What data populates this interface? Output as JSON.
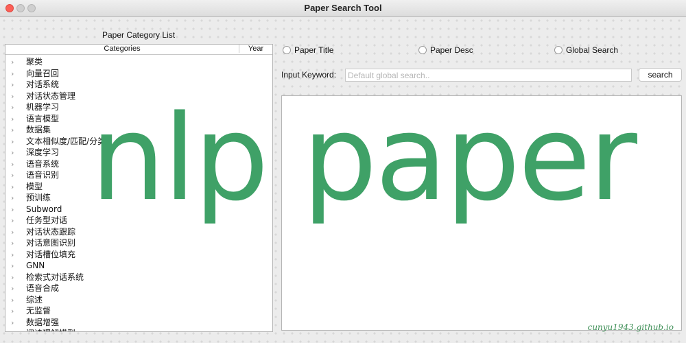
{
  "window": {
    "title": "Paper Search Tool"
  },
  "category_panel": {
    "heading": "Paper Category List",
    "columns": {
      "categories": "Categories",
      "year": "Year"
    },
    "items": [
      "聚类",
      "向量召回",
      "对话系统",
      "对话状态管理",
      "机器学习",
      "语言模型",
      "数据集",
      "文本相似度/匹配/分类",
      "深度学习",
      "语音系统",
      "语音识别",
      "模型",
      "预训练",
      "Subword",
      "任务型对话",
      "对话状态跟踪",
      "对话意图识别",
      "对话槽位填充",
      "GNN",
      "检索式对话系统",
      "语音合成",
      "综述",
      "无监督",
      "数据增强",
      "阅读理解模型"
    ]
  },
  "search_mode": {
    "options": [
      "Paper Title",
      "Paper Desc",
      "Global Search"
    ]
  },
  "keyword": {
    "label": "Input Keyword:",
    "placeholder": "Default global search..",
    "value": ""
  },
  "search_button": {
    "label": "search"
  },
  "overlay": {
    "text": "nlp paper",
    "color": "#3fa167"
  },
  "watermark": {
    "text": "cunyu1943.github.io"
  }
}
